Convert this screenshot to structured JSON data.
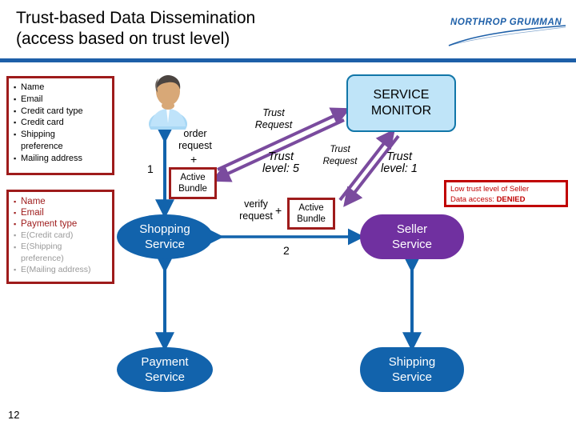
{
  "slide": {
    "page_number": "12",
    "title_lines": [
      "Trust-based Data Dissemination",
      "(access based on trust level)"
    ],
    "logo": {
      "wordmark": "NORTHROP GRUMMAN",
      "brand_color": "#1d5fa8",
      "icon": "swoosh-icon"
    },
    "rule_color": "#1d5fa8"
  },
  "pii_box_plain": {
    "name": "plaintext-attributes-box",
    "border_color": "#9e1b1b",
    "items": [
      {
        "text": "Name",
        "style": "plain"
      },
      {
        "text": "Email",
        "style": "plain"
      },
      {
        "text": "Credit card type",
        "style": "plain"
      },
      {
        "text": "Credit card",
        "style": "plain"
      },
      {
        "text": "Shipping",
        "style": "plain"
      },
      {
        "text": "preference",
        "style": "continuation"
      },
      {
        "text": "Mailing address",
        "style": "plain"
      }
    ]
  },
  "pii_box_encrypted": {
    "name": "encrypted-attributes-box",
    "border_color": "#9e1b1b",
    "clear_color": "#9e1b1b",
    "encrypted_color": "#9a9a9a",
    "items": [
      {
        "text": "Name",
        "style": "clear"
      },
      {
        "text": "Email",
        "style": "clear"
      },
      {
        "text": "Payment type",
        "style": "clear"
      },
      {
        "text": "E(Credit card)",
        "style": "encrypted"
      },
      {
        "text": "E(Shipping",
        "style": "encrypted"
      },
      {
        "text": "preference)",
        "style": "encrypted-continuation"
      },
      {
        "text": "E(Mailing address)",
        "style": "encrypted"
      }
    ]
  },
  "service_monitor": {
    "label_line_1": "SERVICE",
    "label_line_2": "MONITOR",
    "fill": "#bfe4f8",
    "border": "#1176a8"
  },
  "services": [
    {
      "id": "shopping",
      "line1": "Shopping",
      "line2": "Service",
      "color": "#1263ac"
    },
    {
      "id": "payment",
      "line1": "Payment",
      "line2": "Service",
      "color": "#1263ac"
    },
    {
      "id": "seller",
      "line1": "Seller",
      "line2": "Service",
      "color": "#7030a0"
    },
    {
      "id": "shipping",
      "line1": "Shipping",
      "line2": "Service",
      "color": "#1263ac"
    }
  ],
  "bundles": [
    {
      "id": "bundle-1",
      "line1": "Active",
      "line2": "Bundle"
    },
    {
      "id": "bundle-2",
      "line1": "Active",
      "line2": "Bundle"
    }
  ],
  "edge_labels": {
    "order_request": "order\nrequest",
    "plus_1": "+",
    "step_1": "1",
    "verify_request": "verify\nrequest",
    "plus_2": "+",
    "step_2": "2",
    "trust_request_1": "Trust\nRequest",
    "trust_level_5": "Trust\nlevel: 5",
    "trust_request_2": "Trust\nRequest",
    "trust_level_1": "Trust\nlevel: 1"
  },
  "denied_note": {
    "line_1": "Low trust level of Seller",
    "line_2_prefix": "Data access: ",
    "line_2_strong": "DENIED",
    "color": "#c00000"
  },
  "user": {
    "icon": "person-avatar-icon"
  },
  "arrow_colors": {
    "flow": "#1263ac",
    "trust": "#7a4b9e"
  }
}
